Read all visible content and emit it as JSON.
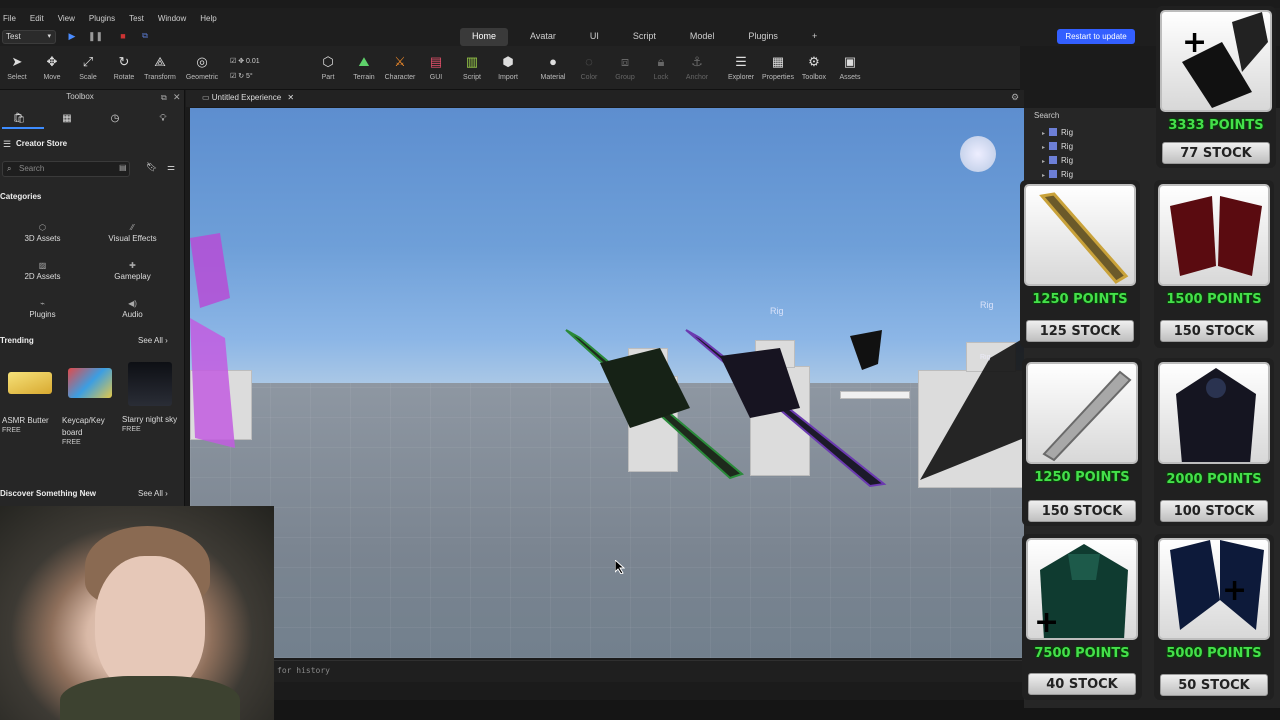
{
  "menu": [
    "File",
    "Edit",
    "View",
    "Plugins",
    "Test",
    "Window",
    "Help"
  ],
  "header": {
    "test_select": "Test",
    "tabs": [
      {
        "label": "Home",
        "active": true
      },
      {
        "label": "Avatar"
      },
      {
        "label": "UI"
      },
      {
        "label": "Script"
      },
      {
        "label": "Model"
      },
      {
        "label": "Plugins"
      },
      {
        "label": "+"
      }
    ],
    "restart_label": "Restart to update"
  },
  "ribbon": {
    "tools": [
      "Select",
      "Move",
      "Scale",
      "Rotate",
      "Transform",
      "Geometric",
      "Part",
      "Terrain",
      "Character",
      "GUI",
      "Script",
      "Import",
      "Material",
      "Color",
      "Group",
      "Lock",
      "Anchor",
      "Explorer",
      "Properties",
      "Toolbox",
      "Assets"
    ],
    "move_step": "0.01",
    "rotate_step": "5°"
  },
  "toolbox": {
    "title": "Toolbox",
    "store_title": "Creator Store",
    "search_placeholder": "Search",
    "categories_label": "Categories",
    "categories": [
      "3D Assets",
      "Visual Effects",
      "2D Assets",
      "Gameplay",
      "Plugins",
      "Audio"
    ],
    "trending_label": "Trending",
    "see_all": "See All",
    "trending": [
      {
        "name": "ASMR Butter",
        "price": "FREE"
      },
      {
        "name": "Keycap/Key board",
        "price": "FREE"
      },
      {
        "name": "Starry night sky",
        "price": "FREE"
      }
    ],
    "discover_label": "Discover Something New"
  },
  "viewport": {
    "tab_title": "Untitled Experience",
    "rig_labels": [
      "Rig",
      "Rig",
      "Rig"
    ],
    "output_hint": "for history"
  },
  "explorer": {
    "search_label": "Search",
    "rows": [
      "Rig",
      "Rig",
      "Rig",
      "Rig"
    ]
  },
  "shop": {
    "cards": [
      {
        "points": "3333 POINTS",
        "stock": "77 STOCK"
      },
      {
        "points": "1250 POINTS",
        "stock": "125 STOCK"
      },
      {
        "points": "1500 POINTS",
        "stock": "150 STOCK"
      },
      {
        "points": "1250 POINTS",
        "stock": "150 STOCK"
      },
      {
        "points": "2000 POINTS",
        "stock": "100 STOCK"
      },
      {
        "points": "7500 POINTS",
        "stock": "40 STOCK"
      },
      {
        "points": "5000 POINTS",
        "stock": "50 STOCK"
      }
    ]
  },
  "colors": {
    "accent": "#335fff",
    "points_green": "#44e04a",
    "active_tab_underline": "#3d8cff"
  }
}
